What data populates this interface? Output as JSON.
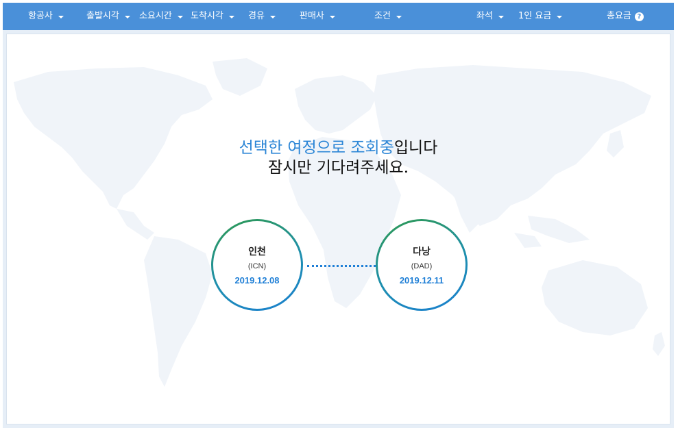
{
  "nav": {
    "airline": "항공사",
    "departure_time": "출발시각",
    "duration": "소요시간",
    "arrival_time": "도착시각",
    "stopover": "경유",
    "seller": "판매사",
    "conditions": "조건",
    "seat": "좌석",
    "per_person_fare": "1인 요금",
    "total_fare": "총요금",
    "help_icon": "question-circle-icon"
  },
  "loading": {
    "highlight": "선택한 여정으로 조회중",
    "rest": "입니다",
    "line2": "잠시만 기다려주세요."
  },
  "origin": {
    "city": "인천",
    "code": "(ICN)",
    "date": "2019.12.08"
  },
  "destination": {
    "city": "다낭",
    "code": "(DAD)",
    "date": "2019.12.11"
  },
  "colors": {
    "accent": "#4a90d9",
    "highlight_text": "#2c86d6",
    "date_text": "#1f7fd6",
    "circle_green": "#2f9a4e",
    "circle_blue": "#1a7fd0"
  }
}
